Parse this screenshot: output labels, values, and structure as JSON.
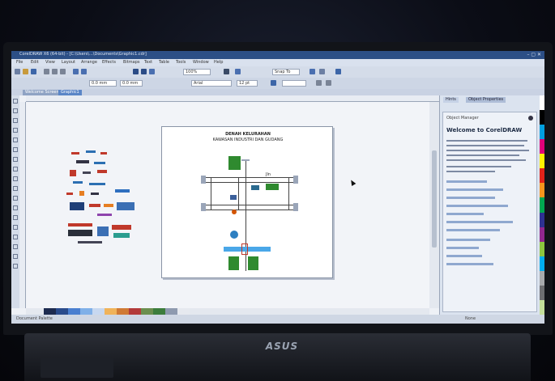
{
  "screen": {
    "app_title": "CorelDRAW X6 (64-bit) - [C:\\Users\\...\\Documents\\Graphic1.cdr]",
    "menu": [
      "File",
      "Edit",
      "View",
      "Layout",
      "Arrange",
      "Effects",
      "Bitmaps",
      "Text",
      "Table",
      "Tools",
      "Window",
      "Help"
    ],
    "toolbar": {
      "zoom_value": "100%",
      "font_name": "Arial",
      "font_size": "12 pt",
      "x_value": "0.0 mm",
      "y_value": "0.0 mm",
      "snap_label": "Snap To"
    },
    "document_tabs": [
      "Welcome Screen",
      "Graphic1"
    ],
    "drawing": {
      "title_line1": "DENAH KELURAHAN",
      "title_line2": "KAWASAN INDUSTRI DAN GUDANG",
      "label_right": "Jln"
    },
    "docker": {
      "tabs": [
        "Hints",
        "Object Properties"
      ],
      "header": "Object Manager",
      "welcome_title": "Welcome to CorelDRAW",
      "links": [
        "Getting started",
        "Creating a new document",
        "Drawing shapes",
        "Working with objects",
        "Adding text",
        "Applying fills and outlines",
        "Working with color",
        "Using effects",
        "Printing",
        "Exporting",
        "More resources"
      ]
    },
    "status": {
      "left": "Document Palette",
      "right": "None"
    }
  },
  "hardware": {
    "brand": "ASUS"
  }
}
